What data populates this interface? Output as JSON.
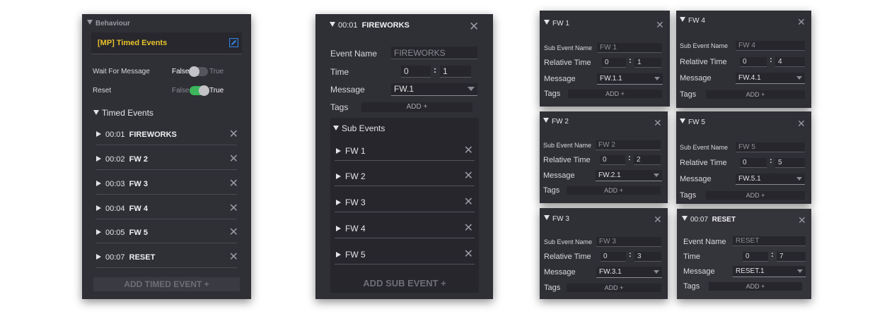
{
  "behaviour": {
    "header": "Behaviour",
    "component_title": "[MP] Timed Events",
    "wait_label": "Wait For Message",
    "reset_label": "Reset",
    "false_label": "False",
    "true_label": "True",
    "wait_value": false,
    "reset_value": true,
    "timed_header": "Timed Events",
    "events": [
      {
        "time": "00:01",
        "name": "FIREWORKS"
      },
      {
        "time": "00:02",
        "name": "FW 2"
      },
      {
        "time": "00:03",
        "name": "FW 3"
      },
      {
        "time": "00:04",
        "name": "FW 4"
      },
      {
        "time": "00:05",
        "name": "FW 5"
      },
      {
        "time": "00:07",
        "name": "RESET"
      }
    ],
    "add_button": "ADD TIMED EVENT +",
    "colors": {
      "toggle_on": "#3db55c",
      "title_yellow": "#e8c22a",
      "edit_blue": "#2f7fe0"
    }
  },
  "fireworks": {
    "time": "00:01",
    "title": "FIREWORKS",
    "event_name_label": "Event Name",
    "event_name_value": "FIREWORKS",
    "time_label": "Time",
    "time_min": "0",
    "time_sec": "1",
    "message_label": "Message",
    "message_value": "FW.1",
    "tags_label": "Tags",
    "add_tag": "ADD +",
    "sub_events_header": "Sub Events",
    "sub_events": [
      "FW 1",
      "FW 2",
      "FW 3",
      "FW 4",
      "FW 5"
    ],
    "add_sub_event": "ADD SUB EVENT +"
  },
  "sub_panels": {
    "fw1": {
      "title": "FW 1",
      "name_label": "Sub Event Name",
      "name_value": "FW 1",
      "rel_label": "Relative Time",
      "min": "0",
      "sec": "1",
      "msg_label": "Message",
      "msg_value": "FW.1.1",
      "tags_label": "Tags",
      "add": "ADD +"
    },
    "fw2": {
      "title": "FW 2",
      "name_label": "Sub Event Name",
      "name_value": "FW 2",
      "rel_label": "Relative Time",
      "min": "0",
      "sec": "2",
      "msg_label": "Message",
      "msg_value": "FW.2.1",
      "tags_label": "Tags",
      "add": "ADD +"
    },
    "fw3": {
      "title": "FW 3",
      "name_label": "Sub Event Name",
      "name_value": "FW 3",
      "rel_label": "Relative Time",
      "min": "0",
      "sec": "3",
      "msg_label": "Message",
      "msg_value": "FW.3.1",
      "tags_label": "Tags",
      "add": "ADD +"
    },
    "fw4": {
      "title": "FW 4",
      "name_label": "Sub Event Name",
      "name_value": "FW 4",
      "rel_label": "Relative Time",
      "min": "0",
      "sec": "4",
      "msg_label": "Message",
      "msg_value": "FW.4.1",
      "tags_label": "Tags",
      "add": "ADD +"
    },
    "fw5": {
      "title": "FW 5",
      "name_label": "Sub Event Name",
      "name_value": "FW 5",
      "rel_label": "Relative Time",
      "min": "0",
      "sec": "5",
      "msg_label": "Message",
      "msg_value": "FW.5.1",
      "tags_label": "Tags",
      "add": "ADD +"
    }
  },
  "reset_panel": {
    "time": "00:07",
    "title": "RESET",
    "event_name_label": "Event Name",
    "event_name_value": "RESET",
    "time_label": "Time",
    "min": "0",
    "sec": "7",
    "message_label": "Message",
    "message_value": "RESET.1",
    "tags_label": "Tags",
    "add": "ADD +"
  }
}
